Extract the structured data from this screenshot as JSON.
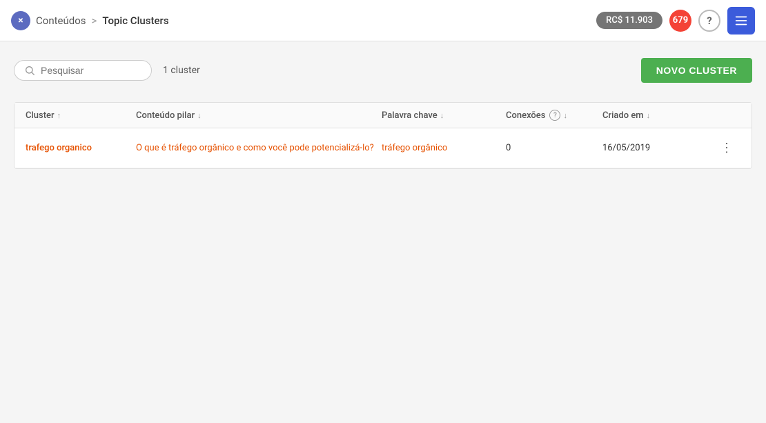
{
  "header": {
    "close_label": "×",
    "breadcrumb_parent": "Conteúdos",
    "breadcrumb_separator": ">",
    "breadcrumb_current": "Topic Clusters",
    "balance": "RC$ 11.903",
    "notifications": "679",
    "help_label": "?"
  },
  "toolbar": {
    "search_placeholder": "Pesquisar",
    "cluster_count": "1 cluster",
    "novo_cluster_label": "NOVO CLUSTER"
  },
  "table": {
    "columns": [
      {
        "label": "Cluster",
        "sortable": true
      },
      {
        "label": "Conteúdo pilar",
        "sortable": true
      },
      {
        "label": "Palavra chave",
        "sortable": true
      },
      {
        "label": "Conexões",
        "sortable": true,
        "has_help": true
      },
      {
        "label": "Criado em",
        "sortable": true
      }
    ],
    "rows": [
      {
        "cluster": "trafego organico",
        "conteudo": "O que é tráfego orgânico e como você pode potencializá-lo?",
        "palavra_chave": "tráfego orgânico",
        "conexoes": "0",
        "criado_em": "16/05/2019"
      }
    ]
  }
}
